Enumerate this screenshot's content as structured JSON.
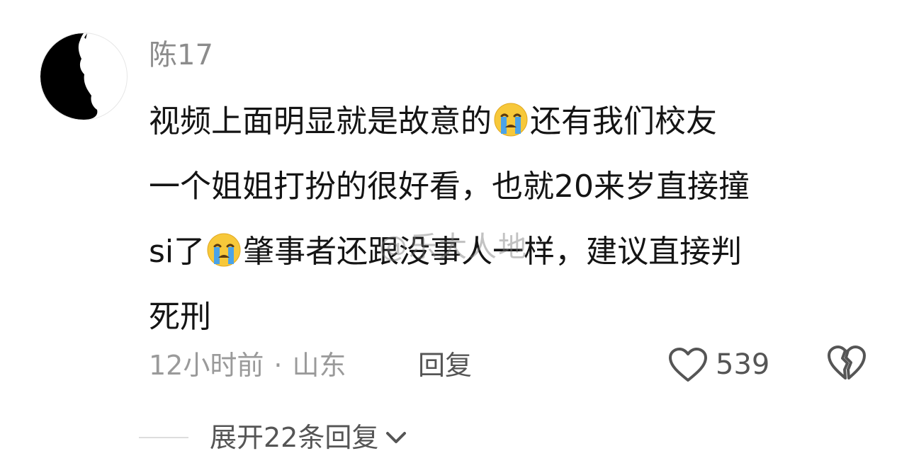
{
  "comment": {
    "username": "陈17",
    "avatar_icon": "black-cat-silhouette-avatar",
    "content_lines": [
      {
        "before": "视频上面明显就是故意的",
        "emoji": "crying-face-emoji",
        "after": "还有我们校友"
      },
      {
        "before": "一个姐姐打扮的很好看，也就20来岁直接撞",
        "emoji": "",
        "after": ""
      },
      {
        "before": "si了",
        "emoji": "crying-face-emoji",
        "after": "肇事者还跟没事人一样，建议直接判"
      },
      {
        "before": "死刑",
        "emoji": "",
        "after": ""
      }
    ],
    "watermark": "@乐大人地",
    "time": "12小时前",
    "separator": "·",
    "location": "山东",
    "reply_label": "回复",
    "like_icon": "heart-outline-icon",
    "like_count": "539",
    "dislike_icon": "broken-heart-icon",
    "expand_label": "展开22条回复",
    "expand_icon": "chevron-down-icon"
  },
  "colors": {
    "username": "#8c8c8c",
    "content": "#141414",
    "meta": "#9a9a9a",
    "action": "#555555",
    "emoji_face": "#f7c83a",
    "emoji_tears": "#4aa3e8"
  }
}
